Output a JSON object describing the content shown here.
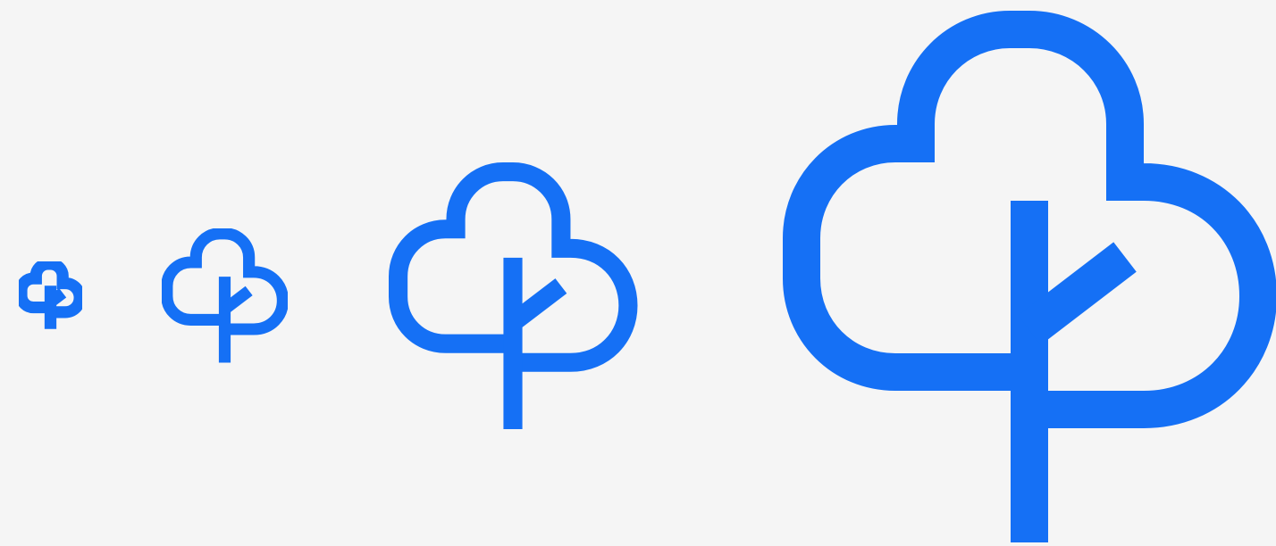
{
  "icon": {
    "name": "tree-icon",
    "color": "#1570f5",
    "variant_count": 4
  },
  "background_color": "#f5f5f5"
}
